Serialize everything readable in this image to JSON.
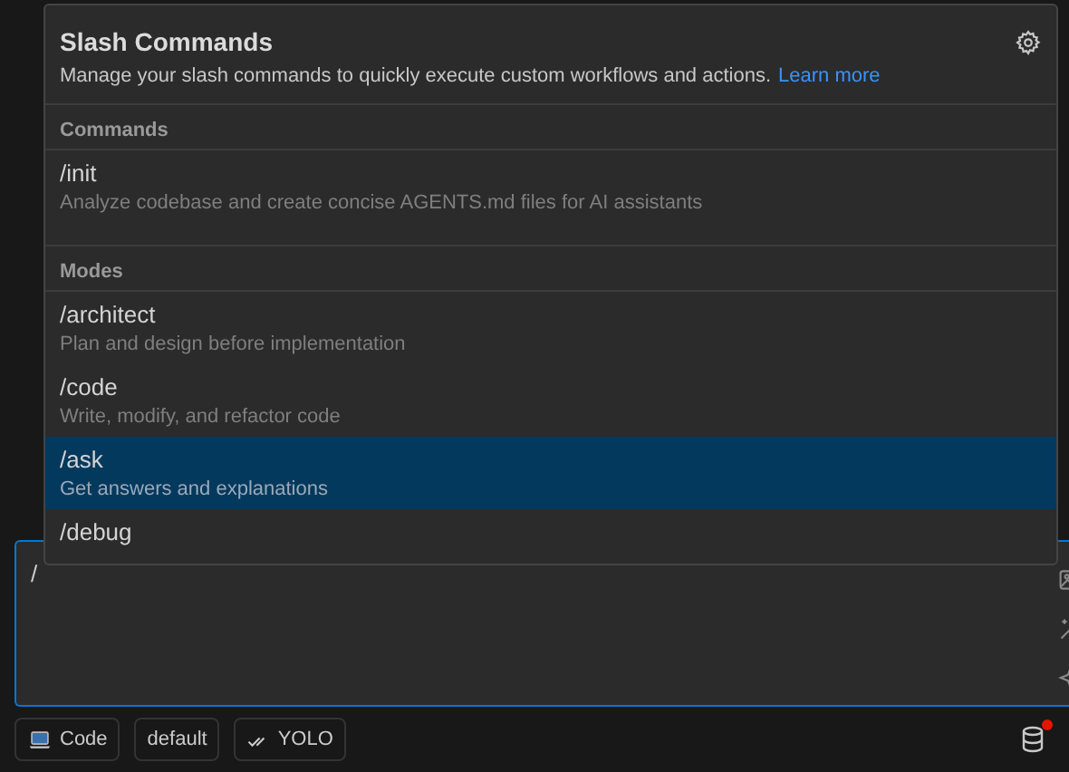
{
  "popup": {
    "title": "Slash Commands",
    "description": "Manage your slash commands to quickly execute custom workflows and actions.",
    "link": "Learn more",
    "sections": [
      {
        "heading": "Commands",
        "items": [
          {
            "name": "/init",
            "description": "Analyze codebase and create concise AGENTS.md files for AI assistants",
            "selected": false
          }
        ]
      },
      {
        "heading": "Modes",
        "items": [
          {
            "name": "/architect",
            "description": "Plan and design before implementation",
            "selected": false
          },
          {
            "name": "/code",
            "description": "Write, modify, and refactor code",
            "selected": false
          },
          {
            "name": "/ask",
            "description": "Get answers and explanations",
            "selected": true
          },
          {
            "name": "/debug",
            "selected": false
          }
        ]
      }
    ]
  },
  "input": {
    "value": "/"
  },
  "bottom_bar": {
    "buttons": [
      {
        "kind": "mode",
        "label": "Code"
      },
      {
        "kind": "plain",
        "label": "default"
      },
      {
        "kind": "auto",
        "label": "YOLO"
      }
    ],
    "notification": true
  }
}
